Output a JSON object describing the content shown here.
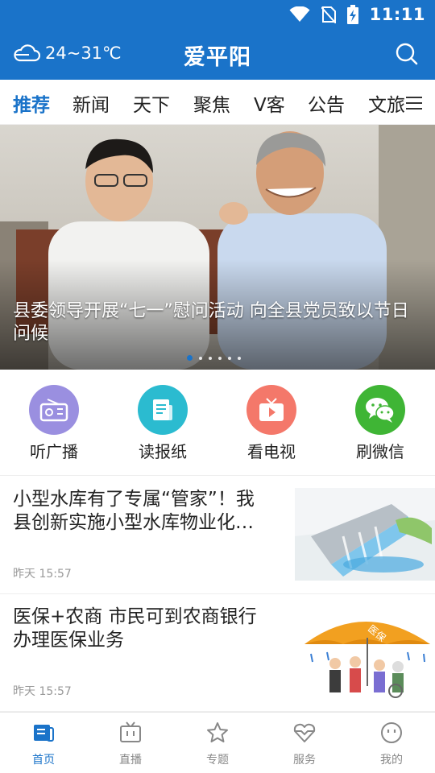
{
  "status": {
    "time": "11:11",
    "icons": [
      "wifi-icon",
      "no-sim-icon",
      "battery-charging-icon"
    ]
  },
  "header": {
    "weather_icon": "cloud-icon",
    "weather": "24~31℃",
    "title": "爱平阳",
    "search_icon": "search-icon"
  },
  "tabs": {
    "items": [
      {
        "label": "推荐",
        "active": true
      },
      {
        "label": "新闻"
      },
      {
        "label": "天下"
      },
      {
        "label": "聚焦"
      },
      {
        "label": "V客"
      },
      {
        "label": "公告"
      },
      {
        "label": "文旅"
      }
    ],
    "menu_icon": "menu-icon"
  },
  "banner": {
    "caption": "县委领导开展“七一”慰问活动 向全县党员致以节日问候",
    "slide_count": 6,
    "active_slide": 1
  },
  "quick": {
    "items": [
      {
        "label": "听广播",
        "icon": "radio-icon",
        "color": "#9a8fe0"
      },
      {
        "label": "读报纸",
        "icon": "newspaper-icon",
        "color": "#2bbbd0"
      },
      {
        "label": "看电视",
        "icon": "tv-icon",
        "color": "#f4786a"
      },
      {
        "label": "刷微信",
        "icon": "wechat-icon",
        "color": "#3fb535"
      }
    ]
  },
  "news": [
    {
      "title": "小型水库有了专属“管家”！我县创新实施小型水库物业化…",
      "time": "昨天 15:57",
      "thumb": "dam-illustration"
    },
    {
      "title": "医保+农商 市民可到农商银行办理医保业务",
      "time": "昨天 15:57",
      "thumb": "medical-insurance-umbrella",
      "thumb_text": "医保"
    }
  ],
  "bottomnav": {
    "items": [
      {
        "label": "首页",
        "icon": "home-icon",
        "active": true
      },
      {
        "label": "直播",
        "icon": "live-tv-icon"
      },
      {
        "label": "专题",
        "icon": "star-icon"
      },
      {
        "label": "服务",
        "icon": "service-heart-icon"
      },
      {
        "label": "我的",
        "icon": "profile-icon"
      }
    ]
  },
  "colors": {
    "primary": "#1a73c9",
    "text": "#222222",
    "muted": "#999999"
  }
}
